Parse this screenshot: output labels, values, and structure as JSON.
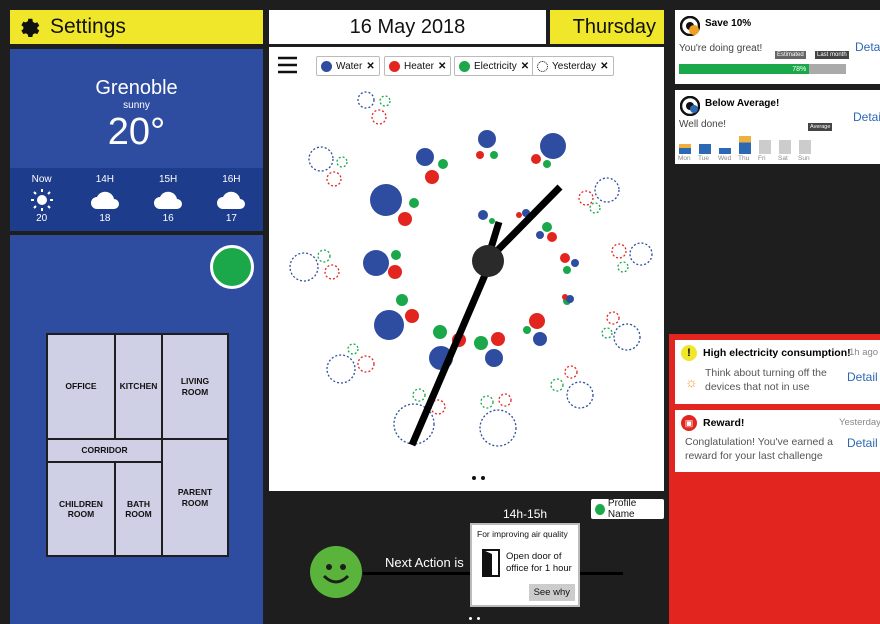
{
  "settings": {
    "label": "Settings",
    "icon": "gear-icon"
  },
  "date": "16 May 2018",
  "day": "Thursday",
  "weather": {
    "city": "Grenoble",
    "condition": "sunny",
    "temp": "20°",
    "forecast": [
      {
        "time": "Now",
        "icon": "sun-icon",
        "temp": "20"
      },
      {
        "time": "14H",
        "icon": "cloud-icon",
        "temp": "18"
      },
      {
        "time": "15H",
        "icon": "cloud-icon",
        "temp": "16"
      },
      {
        "time": "16H",
        "icon": "cloud-icon",
        "temp": "17"
      }
    ]
  },
  "rooms": {
    "office": "OFFICE",
    "kitchen": "KITCHEN",
    "living": "LIVING ROOM",
    "corridor": "CORRIDOR",
    "children": "CHILDREN ROOM",
    "bath": "BATH ROOM",
    "parent": "PARENT ROOM"
  },
  "filters": [
    {
      "label": "Water",
      "color": "#2f4da0"
    },
    {
      "label": "Heater",
      "color": "#e3251f"
    },
    {
      "label": "Electricity",
      "color": "#1aa84a"
    },
    {
      "label": "Yesterday",
      "color": "#ffffff"
    }
  ],
  "colors": {
    "water": "#2f4da0",
    "heater": "#e3251f",
    "electricity": "#1aa84a",
    "yellow": "#f0e62a",
    "red_panel": "#e3251f"
  },
  "action": {
    "time": "14h-15h",
    "profile": "Profile Name",
    "next_label": "Next Action is",
    "purpose": "For improving air quality",
    "instruction": "Open door of office for 1 hour",
    "why": "See why"
  },
  "goal_card": {
    "title": "Save 10%",
    "message": "You're doing great!",
    "estimated": "Estimated",
    "last_month": "Last month",
    "progress_label": "78%",
    "progress": 0.78,
    "detail": "Detai"
  },
  "average_card": {
    "title": "Below Average!",
    "message": "Well done!",
    "average": "Average",
    "detail": "Detail",
    "days": [
      "Mon",
      "Tue",
      "Wed",
      "Thu",
      "Fri",
      "Sat",
      "Sun"
    ]
  },
  "alert_card": {
    "title": "High electricity consumption!",
    "time": "1h ago",
    "message": "Think about turning off the devices that not in use",
    "detail": "Detail"
  },
  "reward_card": {
    "title": "Reward!",
    "time": "Yesterday",
    "message": "Conglatulation! You've earned a reward for your last challenge",
    "detail": "Detail"
  }
}
